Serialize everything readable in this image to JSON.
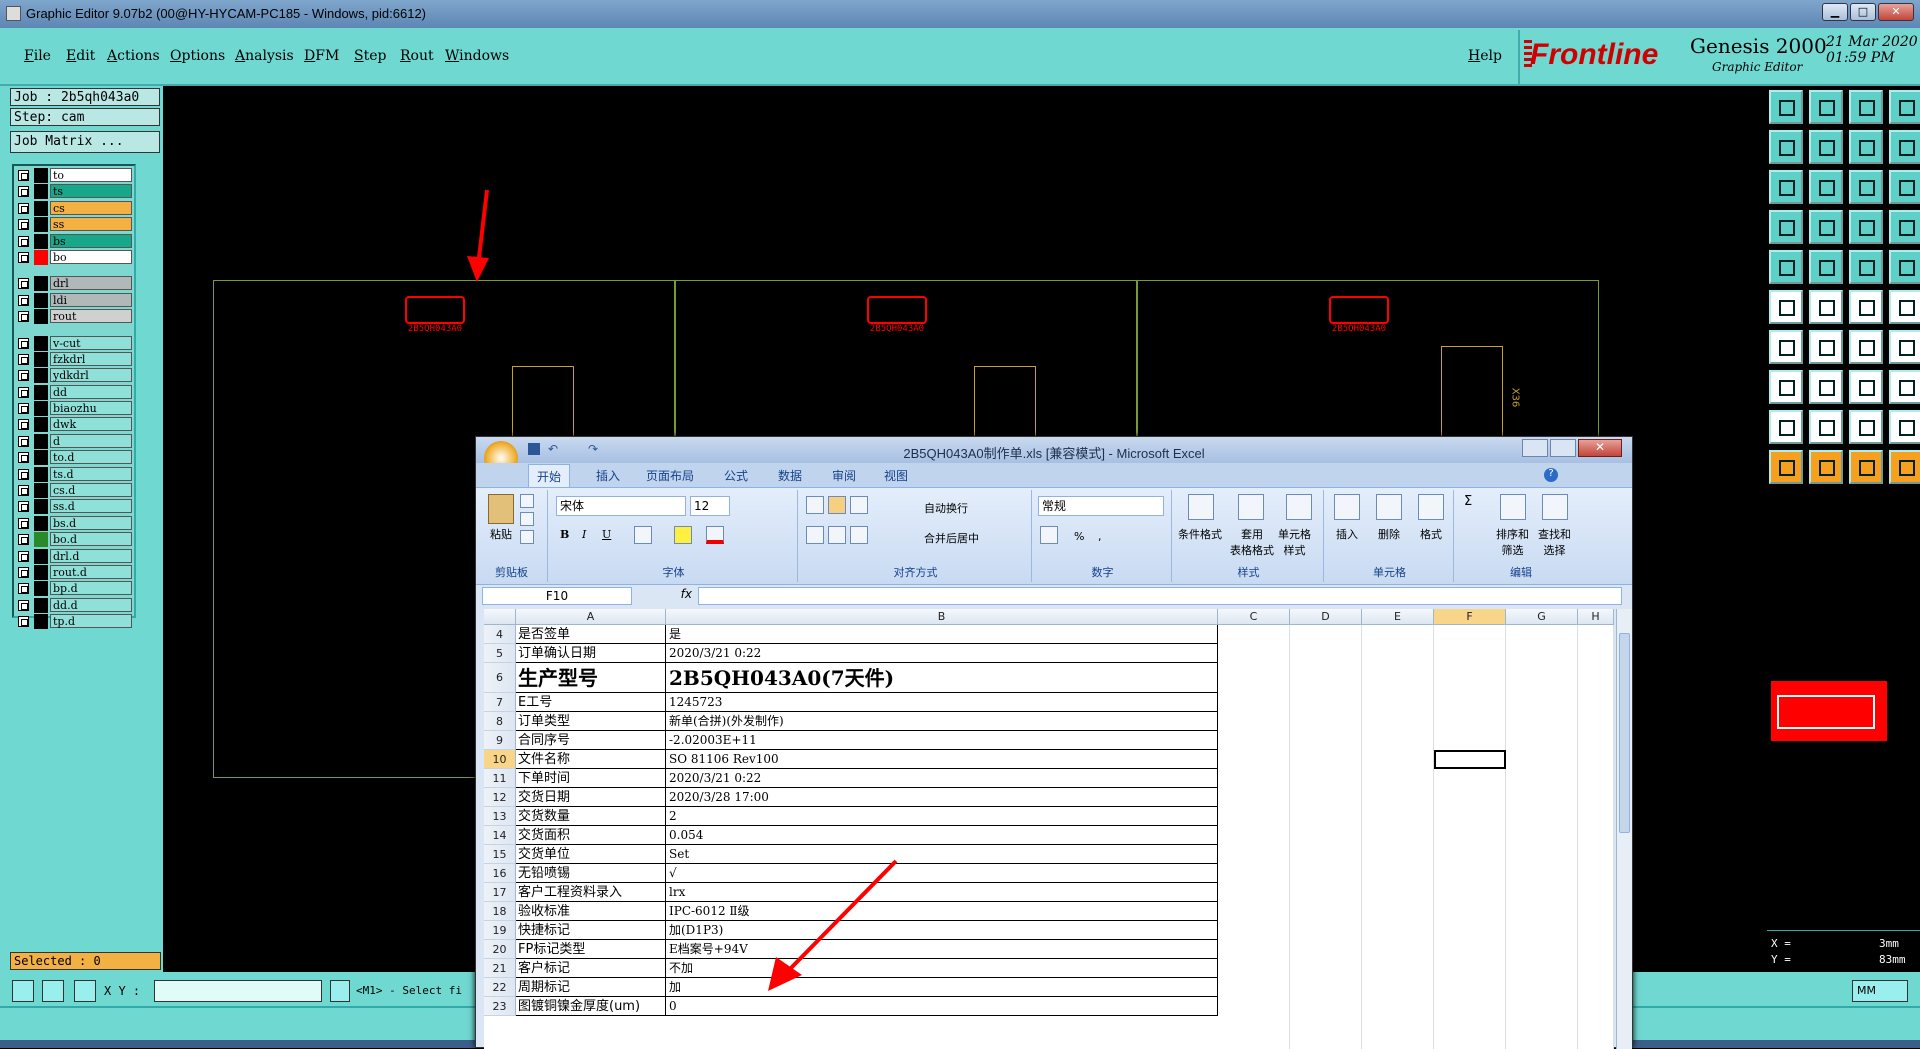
{
  "window": {
    "title": "Graphic Editor 9.07b2 (00@HY-HYCAM-PC185 - Windows, pid:6612)",
    "min": "▁",
    "max": "□",
    "close": "✕"
  },
  "menu": [
    "File",
    "Edit",
    "Actions",
    "Options",
    "Analysis",
    "DFM",
    "Step",
    "Rout",
    "Windows"
  ],
  "help": "Help",
  "logo": {
    "brand": "Frontline",
    "product": "Genesis 2000",
    "subtitle": "Graphic Editor",
    "date": "21 Mar 2020",
    "time": "01:59 PM"
  },
  "job": {
    "job": "Job : 2b5qh043a0",
    "step": "Step: cam",
    "matrix": "Job Matrix ..."
  },
  "layers": [
    {
      "name": "to",
      "color": "#ffffff",
      "swatch": "#000000"
    },
    {
      "name": "ts",
      "color": "#17a88a",
      "swatch": "#000000"
    },
    {
      "name": "cs",
      "color": "#f3b043",
      "swatch": "#000000"
    },
    {
      "name": "ss",
      "color": "#f3b043",
      "swatch": "#000000"
    },
    {
      "name": "bs",
      "color": "#17a88a",
      "swatch": "#000000"
    },
    {
      "name": "bo",
      "color": "#ffffff",
      "swatch": "#ff0000"
    },
    {
      "name": "drl",
      "color": "#b0b8b8",
      "swatch": "#000000"
    },
    {
      "name": "ldi",
      "color": "#b0b8b8",
      "swatch": "#000000"
    },
    {
      "name": "rout",
      "color": "#d0d0d0",
      "swatch": "#000000"
    },
    {
      "name": "v-cut",
      "color": "#8fe0d8",
      "swatch": "#000000"
    },
    {
      "name": "fzkdrl",
      "color": "#8fe0d8",
      "swatch": "#000000"
    },
    {
      "name": "ydkdrl",
      "color": "#8fe0d8",
      "swatch": "#000000"
    },
    {
      "name": "dd",
      "color": "#8fe0d8",
      "swatch": "#000000"
    },
    {
      "name": "biaozhu",
      "color": "#8fe0d8",
      "swatch": "#000000"
    },
    {
      "name": "dwk",
      "color": "#8fe0d8",
      "swatch": "#000000"
    },
    {
      "name": "d",
      "color": "#8fe0d8",
      "swatch": "#000000"
    },
    {
      "name": "to.d",
      "color": "#8fe0d8",
      "swatch": "#000000"
    },
    {
      "name": "ts.d",
      "color": "#8fe0d8",
      "swatch": "#000000"
    },
    {
      "name": "cs.d",
      "color": "#8fe0d8",
      "swatch": "#000000"
    },
    {
      "name": "ss.d",
      "color": "#8fe0d8",
      "swatch": "#000000"
    },
    {
      "name": "bs.d",
      "color": "#8fe0d8",
      "swatch": "#000000"
    },
    {
      "name": "bo.d",
      "color": "#8fe0d8",
      "swatch": "#2a8a2a"
    },
    {
      "name": "drl.d",
      "color": "#8fe0d8",
      "swatch": "#000000"
    },
    {
      "name": "rout.d",
      "color": "#8fe0d8",
      "swatch": "#000000"
    },
    {
      "name": "bp.d",
      "color": "#8fe0d8",
      "swatch": "#000000"
    },
    {
      "name": "dd.d",
      "color": "#8fe0d8",
      "swatch": "#000000"
    },
    {
      "name": "tp.d",
      "color": "#8fe0d8",
      "swatch": "#000000"
    }
  ],
  "selected": "Selected : 0",
  "bottom": {
    "xy_label": "X Y :",
    "xy_value": "",
    "hint": "<M1> - Select fi",
    "units": "MM",
    "x_label": "X =",
    "y_label": "Y =",
    "x_val": "3mm",
    "y_val": "83mm"
  },
  "canvas": {
    "panel_label": "2B5QH043A0",
    "side_mark": "X36"
  },
  "excel": {
    "title": "2B5QH043A0制作单.xls [兼容模式] - Microsoft Excel",
    "tabs": [
      "开始",
      "插入",
      "页面布局",
      "公式",
      "数据",
      "审阅",
      "视图"
    ],
    "groups": {
      "clipboard": "剪贴板",
      "font": "字体",
      "align": "对齐方式",
      "number": "数字",
      "styles": "样式",
      "cells": "单元格",
      "edit": "编辑"
    },
    "ribbon": {
      "paste": "粘贴",
      "font_name": "宋体",
      "font_size": "12",
      "wrap": "自动换行",
      "merge": "合并后居中",
      "num_format": "常规",
      "cond_fmt": "条件格式",
      "table_fmt": "套用\n表格格式",
      "cell_style": "单元格\n样式",
      "insert": "插入",
      "delete": "删除",
      "format": "格式",
      "sort": "排序和\n筛选",
      "find": "查找和\n选择",
      "bold": "B",
      "italic": "I",
      "underline": "U",
      "percent": "%",
      "comma": ",",
      "sigma": "Σ"
    },
    "namebox": "F10",
    "fx": "fx",
    "columns": [
      "A",
      "B",
      "C",
      "D",
      "E",
      "F",
      "G",
      "H"
    ],
    "rows": [
      {
        "n": "4",
        "a": "是否签单",
        "b": "是"
      },
      {
        "n": "5",
        "a": "订单确认日期",
        "b": "2020/3/21 0:22"
      },
      {
        "n": "6",
        "a": "生产型号",
        "b": "2B5QH043A0(7天件)"
      },
      {
        "n": "7",
        "a": "E工号",
        "b": "1245723"
      },
      {
        "n": "8",
        "a": "订单类型",
        "b": "新单(合拼)(外发制作)"
      },
      {
        "n": "9",
        "a": "合同序号",
        "b": "-2.02003E+11"
      },
      {
        "n": "10",
        "a": "文件名称",
        "b": "SO 81106 Rev100"
      },
      {
        "n": "11",
        "a": "下单时间",
        "b": "2020/3/21 0:22"
      },
      {
        "n": "12",
        "a": "交货日期",
        "b": "2020/3/28 17:00"
      },
      {
        "n": "13",
        "a": "交货数量",
        "b": "2"
      },
      {
        "n": "14",
        "a": "交货面积",
        "b": "0.054"
      },
      {
        "n": "15",
        "a": "交货单位",
        "b": "Set"
      },
      {
        "n": "16",
        "a": "无铅喷锡",
        "b": "√"
      },
      {
        "n": "17",
        "a": "客户工程资料录入",
        "b": "lrx"
      },
      {
        "n": "18",
        "a": "验收标准",
        "b": "IPC-6012 Ⅱ级"
      },
      {
        "n": "19",
        "a": "快捷标记",
        "b": "加(D1P3)"
      },
      {
        "n": "20",
        "a": "FP标记类型",
        "b": "E档案号+94V"
      },
      {
        "n": "21",
        "a": "客户标记",
        "b": "不加"
      },
      {
        "n": "22",
        "a": "周期标记",
        "b": "加"
      },
      {
        "n": "23",
        "a": "图镀铜镍金厚度(um)",
        "b": "0"
      }
    ]
  },
  "colors": {
    "app_bg": "#6fd8d0",
    "canvas_bg": "#000000",
    "accent_red": "#ff0000",
    "excel_bg": "#dbe6f4"
  }
}
